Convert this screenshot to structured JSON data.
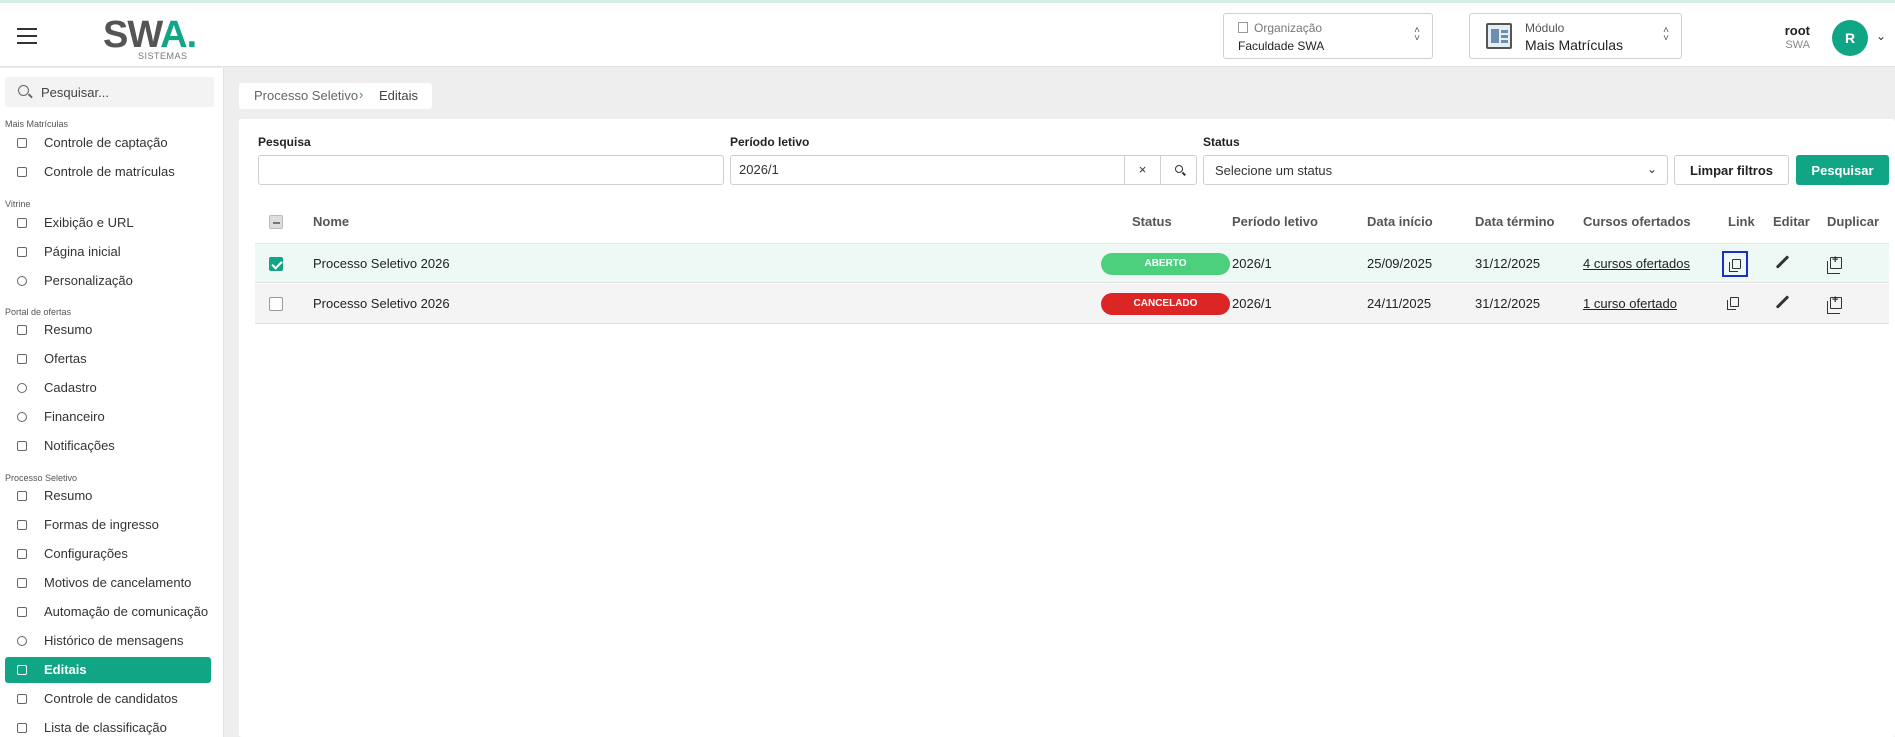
{
  "header": {
    "logo_text_main": "SW",
    "logo_text_accent": "A.",
    "logo_sub": "SISTEMAS",
    "org_label": "Organização",
    "org_value": "Faculdade SWA",
    "module_label": "Módulo",
    "module_value": "Mais Matrículas",
    "user_name": "root",
    "user_org": "SWA",
    "avatar_initial": "R"
  },
  "sidebar": {
    "search_placeholder": "Pesquisar...",
    "sections": {
      "mais_matriculas": "Mais Matrículas",
      "vitrine": "Vitrine",
      "portal": "Portal de ofertas",
      "processo": "Processo Seletivo"
    },
    "items": [
      "Controle de captação",
      "Controle de matrículas",
      "Exibição e URL",
      "Página inicial",
      "Personalização",
      "Resumo",
      "Ofertas",
      "Cadastro",
      "Financeiro",
      "Notificações",
      "Resumo",
      "Formas de ingresso",
      "Configurações",
      "Motivos de cancelamento",
      "Automação de comunicação",
      "Histórico de mensagens",
      "Editais",
      "Controle de candidatos",
      "Lista de classificação"
    ],
    "active_item": "Editais"
  },
  "breadcrumb": {
    "parent": "Processo Seletivo",
    "current": "Editais"
  },
  "filters": {
    "search_label": "Pesquisa",
    "search_value": "",
    "period_label": "Período letivo",
    "period_value": "2026/1",
    "status_label": "Status",
    "status_placeholder": "Selecione um status",
    "clear_label": "Limpar filtros",
    "submit_label": "Pesquisar",
    "clear_icon": "×"
  },
  "table": {
    "headers": {
      "name": "Nome",
      "status": "Status",
      "period": "Período letivo",
      "start": "Data início",
      "end": "Data término",
      "courses": "Cursos ofertados",
      "link": "Link",
      "edit": "Editar",
      "duplicate": "Duplicar"
    },
    "rows": [
      {
        "selected": true,
        "name": "Processo Seletivo 2026",
        "status": "ABERTO",
        "status_color": "#4cd07d",
        "period": "2026/1",
        "start": "25/09/2025",
        "end": "31/12/2025",
        "courses": "4 cursos ofertados"
      },
      {
        "selected": false,
        "name": "Processo Seletivo 2026",
        "status": "CANCELADO",
        "status_color": "#dc2626",
        "period": "2026/1",
        "start": "24/11/2025",
        "end": "31/12/2025",
        "courses": "1 curso ofertado"
      }
    ]
  },
  "colors": {
    "accent": "#0fa585",
    "focus": "#1a2fc9"
  }
}
